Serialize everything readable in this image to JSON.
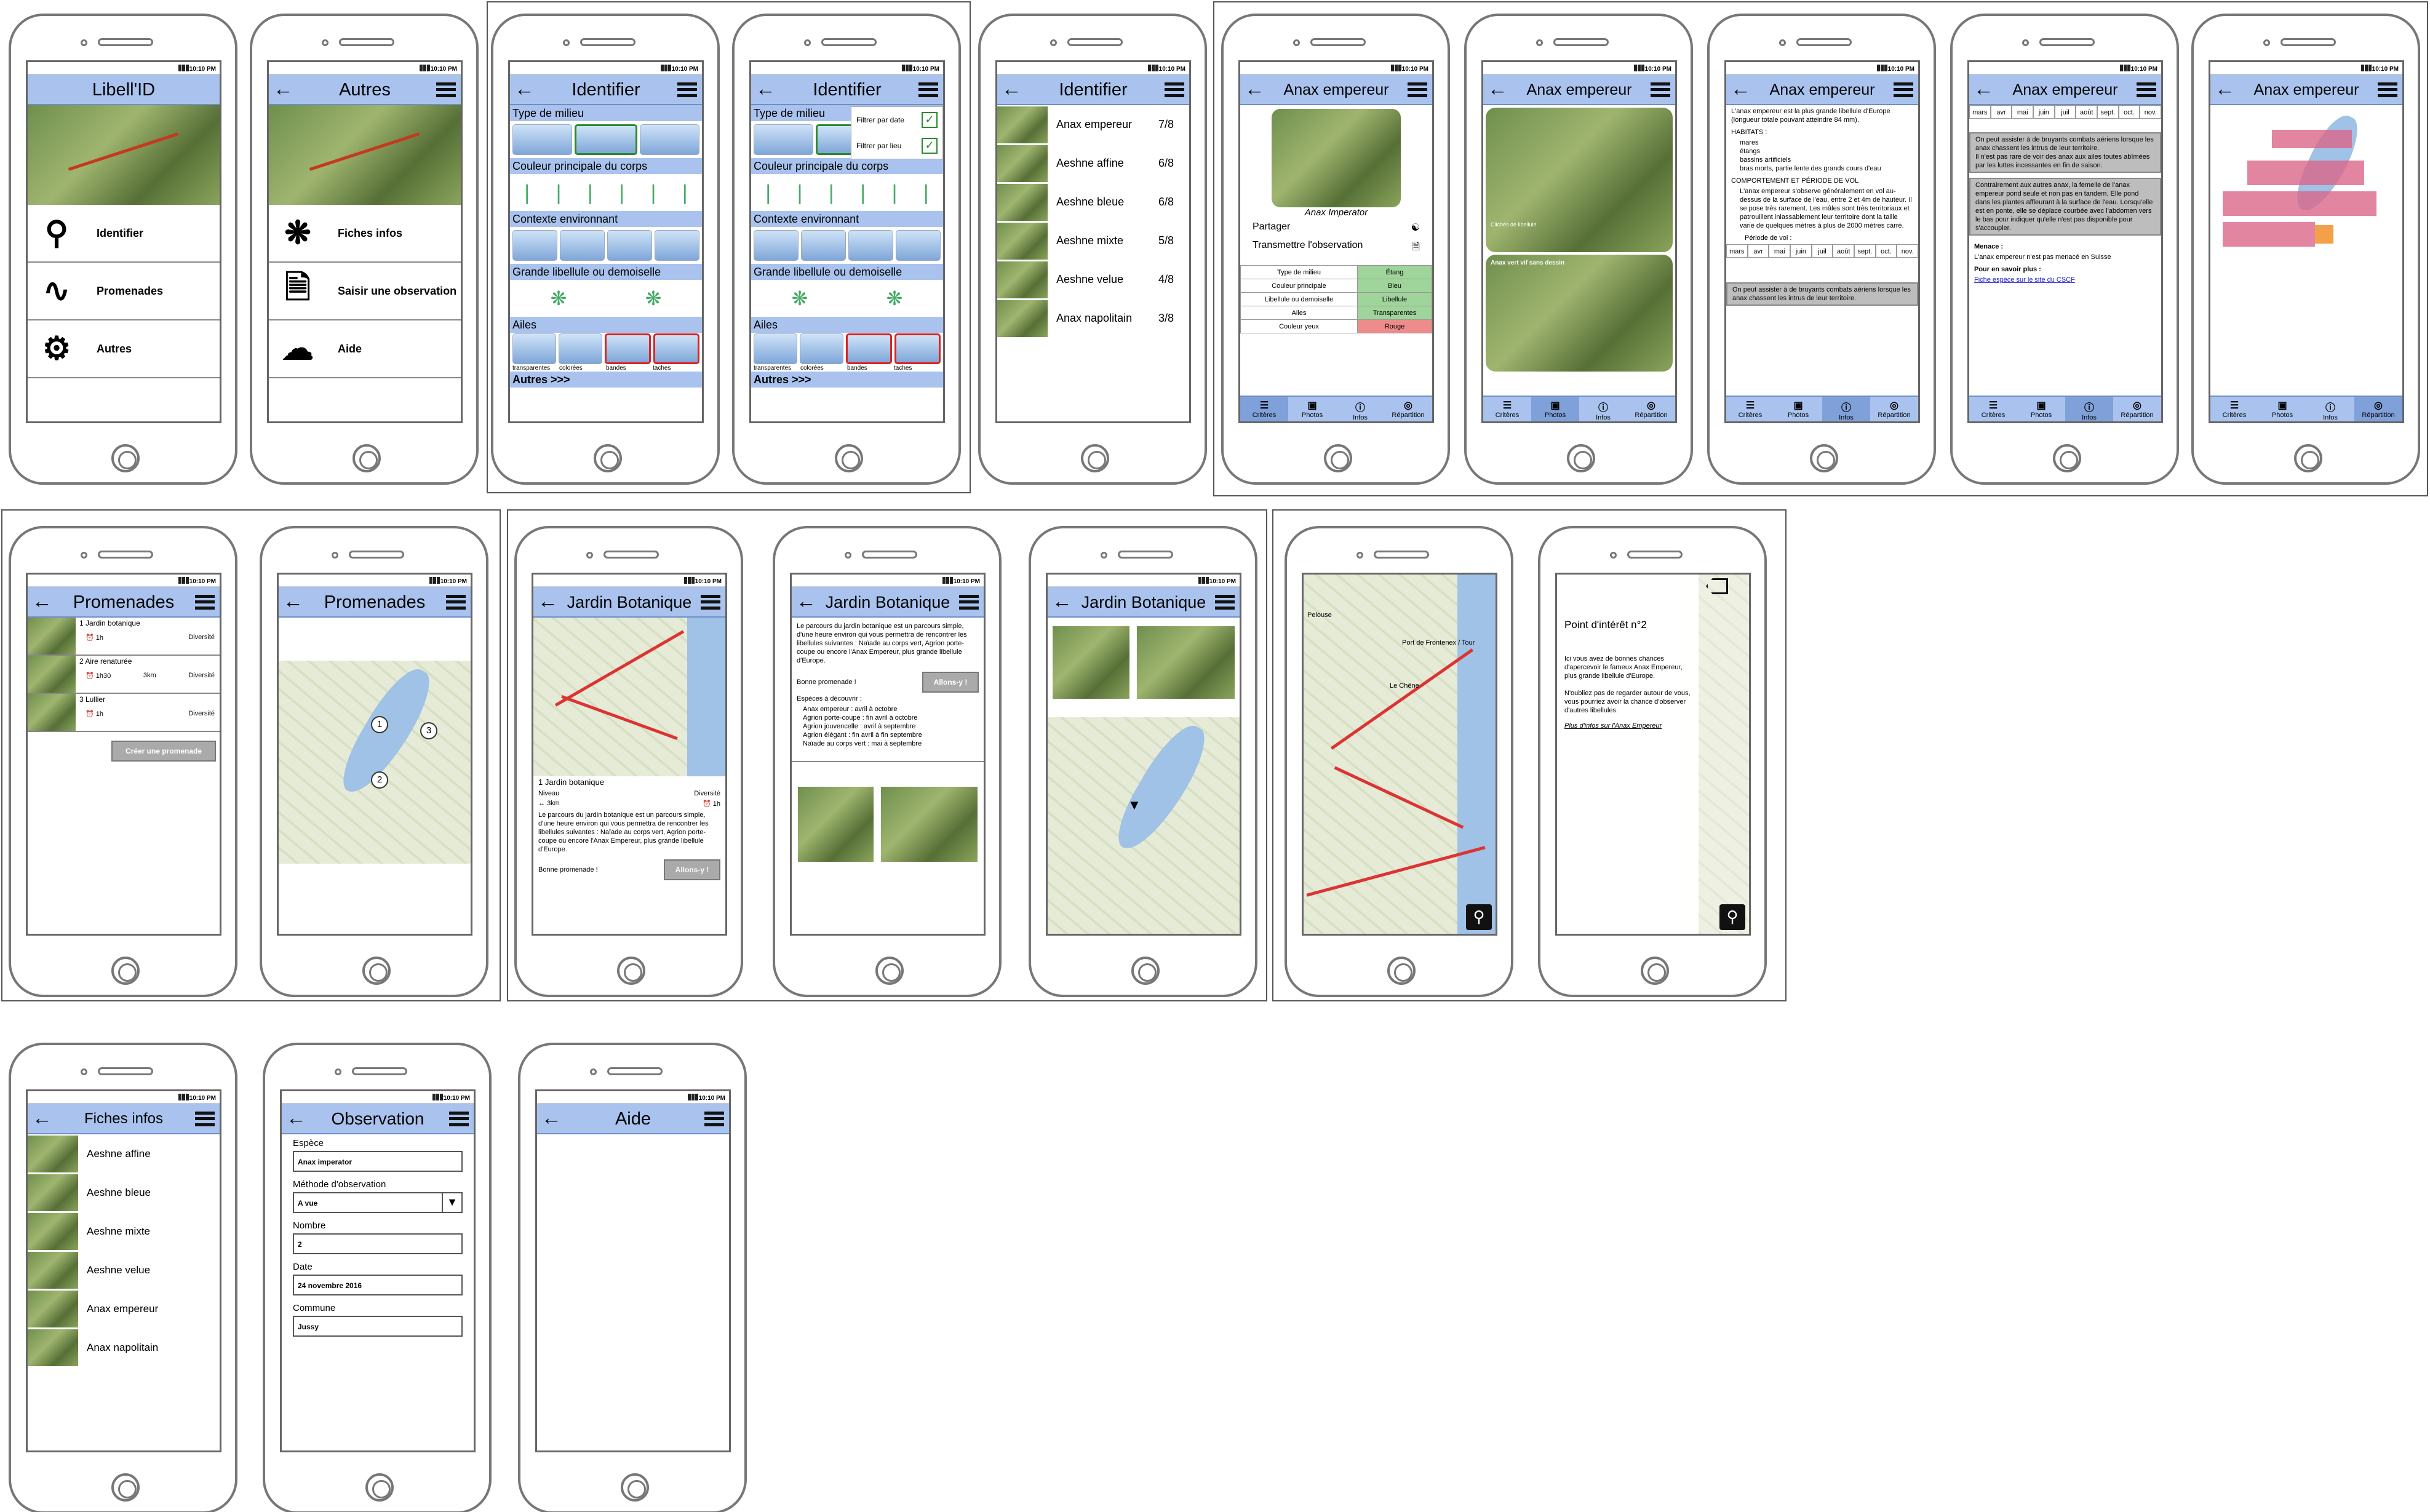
{
  "status": {
    "time": "10:10 PM"
  },
  "home": {
    "title": "Libell'ID",
    "items": [
      "Identifier",
      "Promenades",
      "Autres"
    ]
  },
  "autres": {
    "title": "Autres",
    "items": [
      "Fiches infos",
      "Saisir une observation",
      "Aide"
    ]
  },
  "identifier": {
    "title": "Identifier",
    "sections": [
      "Type de milieu",
      "Couleur principale du corps",
      "Contexte environnant",
      "Grande libellule ou demoiselle",
      "Ailes"
    ],
    "wings": [
      "transparentes",
      "colorées",
      "bandes",
      "taches"
    ],
    "more": "Autres >>>",
    "filters": [
      "Filtrer par date",
      "Filtrer par lieu"
    ]
  },
  "results": [
    {
      "name": "Anax empereur",
      "score": "7/8"
    },
    {
      "name": "Aeshne affine",
      "score": "6/8"
    },
    {
      "name": "Aeshne bleue",
      "score": "6/8"
    },
    {
      "name": "Aeshne mixte",
      "score": "5/8"
    },
    {
      "name": "Aeshne velue",
      "score": "4/8"
    },
    {
      "name": "Anax napolitain",
      "score": "3/8"
    }
  ],
  "species": {
    "title": "Anax empereur",
    "latin": "Anax Imperator",
    "share": "Partager",
    "transmit": "Transmettre l'observation",
    "criteria": [
      [
        "Type de milieu",
        "Étang"
      ],
      [
        "Couleur principale",
        "Bleu"
      ],
      [
        "Libellule ou demoiselle",
        "Libellule"
      ],
      [
        "Ailes",
        "Transparentes"
      ],
      [
        "Couleur yeux",
        "Rouge"
      ]
    ],
    "tabs": [
      "Critères",
      "Photos",
      "Infos",
      "Répartition"
    ],
    "intro": "L'anax empereur est la plus grande libellule d'Europe (longueur totale pouvant atteindre 84 mm).",
    "habitats_title": "HABITATS :",
    "habitats": [
      "mares",
      "étangs",
      "bassins artificiels",
      "bras morts, partie lente des grands cours d'eau"
    ],
    "behaviour_title": "COMPORTEMENT ET PÉRIODE DE VOL",
    "behaviour": "L'anax empereur s'observe généralement en vol au-dessus de la surface de l'eau, entre 2 et 4m de hauteur. Il se pose très rarement. Les mâles sont très territoriaux et patrouillent inlassablement leur territoire dont la taille varie de quelques mètres à plus de 2000 mètres carré.",
    "period": "Période de vol :",
    "months": [
      "mars",
      "avr",
      "mai",
      "juin",
      "juil",
      "août",
      "sept.",
      "oct.",
      "nov."
    ],
    "tip1": "On peut assister à de bruyants combats aériens lorsque les anax chassent les intrus de leur territoire.",
    "tip1b": "Il n'est pas rare de voir des anax aux ailes toutes abîmées par les luttes incessantes en fin de saison.",
    "tip2": "Contrairement aux autres anax, la femelle de l'anax empereur pond seule et non pas en tandem. Elle pond dans les plantes affleurant à la surface de l'eau. Lorsqu'elle est en ponte, elle se déplace courbée avec l'abdomen vers le bas pour indiquer qu'elle n'est pas disponible pour s'accoupler.",
    "threat_title": "Menace :",
    "threat": "L'anax empereur n'est pas menacé en Suisse",
    "more_title": "Pour en savoir plus :",
    "more_link": "Fiche espèce sur le site du CSCF",
    "photo_caption1": "Clichés de libellule",
    "photo_caption2": "Anax vert vif sans dessin"
  },
  "promenades": {
    "title": "Promenades",
    "list": [
      {
        "name": "1 Jardin botanique",
        "time": "1h",
        "div": "Diversité"
      },
      {
        "name": "2 Aire renaturée",
        "time": "1h30",
        "dist": "3km",
        "div": "Diversité"
      },
      {
        "name": "3 Lullier",
        "time": "1h",
        "div": "Diversité"
      }
    ],
    "create": "Créer une promenade",
    "pins": [
      "1",
      "2",
      "3"
    ]
  },
  "jardin": {
    "title": "Jardin Botanique",
    "name": "1 Jardin botanique",
    "level": "Niveau",
    "dist": "3km",
    "div": "Diversité",
    "time": "1h",
    "desc": "Le parcours du jardin botanique est un parcours simple, d'une heure environ qui vous permettra de rencontrer les libellules suivantes : Naïade au corps vert, Agrion porte-coupe ou encore l'Anax Empereur, plus grande libellule d'Europe.",
    "good": "Bonne promenade !",
    "go": "Allons-y !",
    "species_title": "Espèces à découvrir :",
    "species": [
      "Anax empereur : avril à octobre",
      "Agrion porte-coupe : fin avril à octobre",
      "Agrion jouvencelle : avril à septembre",
      "Agrion élégant : fin avril à fin septembre",
      "Naïade au corps vert : mai à septembre"
    ]
  },
  "poi": {
    "title": "Point d'intérêt n°2",
    "p1": "Ici vous avez de bonnes chances d'apercevoir le fameux Anax Empereur, plus grande libellule d'Europe.",
    "p2": "N'oubliez pas de regarder autour de vous, vous pourriez avoir la chance d'observer d'autres libellules.",
    "link": "Plus d'infos sur l'Anax Empereur",
    "map": [
      "Pelouse",
      "Port de Frontenex / Tour",
      "Le Chêne"
    ]
  },
  "fiches": {
    "title": "Fiches infos",
    "items": [
      "Aeshne affine",
      "Aeshne bleue",
      "Aeshne mixte",
      "Aeshne velue",
      "Anax empereur",
      "Anax napolitain"
    ]
  },
  "observation": {
    "title": "Observation",
    "fields": [
      {
        "label": "Espèce",
        "value": "Anax imperator"
      },
      {
        "label": "Méthode d'observation",
        "value": "A vue"
      },
      {
        "label": "Nombre",
        "value": "2"
      },
      {
        "label": "Date",
        "value": "24 novembre 2016"
      },
      {
        "label": "Commune",
        "value": "Jussy"
      }
    ]
  },
  "aide": {
    "title": "Aide"
  },
  "colors": {
    "bar": "#a9c3ee",
    "green": "#9fd49a",
    "red": "#ee8c8c"
  }
}
